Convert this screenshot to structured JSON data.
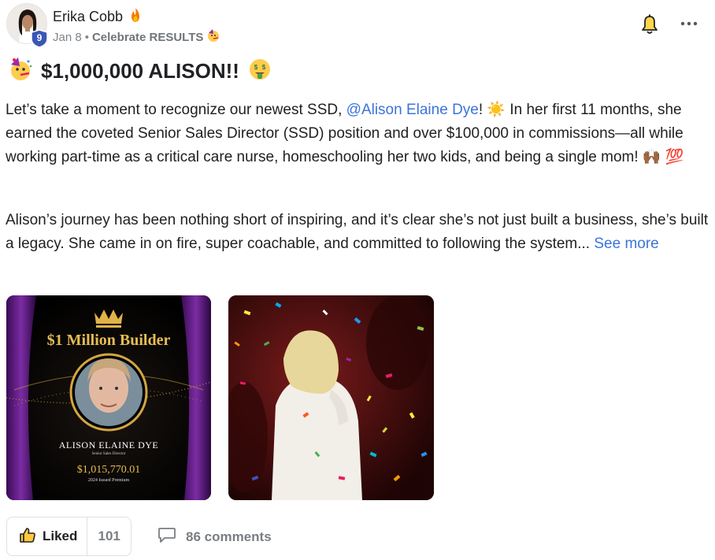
{
  "post": {
    "author": "Erika Cobb",
    "level": "9",
    "date": "Jan 8",
    "separator": "•",
    "category": "Celebrate RESULTS",
    "title": "$1,000,000 ALISON!!",
    "p1": {
      "before": "Let’s take a moment to recognize our newest SSD, ",
      "mention": "@Alison Elaine Dye",
      "after": "! ☀️ In her first 11 months, she earned the coveted Senior Sales Director (SSD) position and over $100,000 in commissions—all while working part-time as a critical care nurse, homeschooling her two kids, and being a single mom! 🙌🏾 💯"
    },
    "p2": {
      "text": "Alison’s journey has been nothing short of inspiring, and it’s clear she’s not just built a business, she’s built a legacy. She came in on fire, super coachable, and committed to following the system... ",
      "see_more": "See more"
    }
  },
  "award_card": {
    "heading": "$1 Million Builder",
    "name": "ALISON ELAINE DYE",
    "role": "Senior Sales Director",
    "amount": "$1,015,770.01",
    "caption": "2024 Issued Premium"
  },
  "actions": {
    "like_label": "Liked",
    "like_count": "101",
    "comments_label": "86 comments"
  },
  "colors": {
    "mention": "#3b74d9",
    "badge": "#3a56b5",
    "gold": "#d4a640",
    "muted": "#7a7e83"
  },
  "icons": [
    "fire-icon",
    "party-face-icon",
    "money-face-icon",
    "bell-icon",
    "more-icon",
    "thumbs-up-icon",
    "comment-icon"
  ]
}
